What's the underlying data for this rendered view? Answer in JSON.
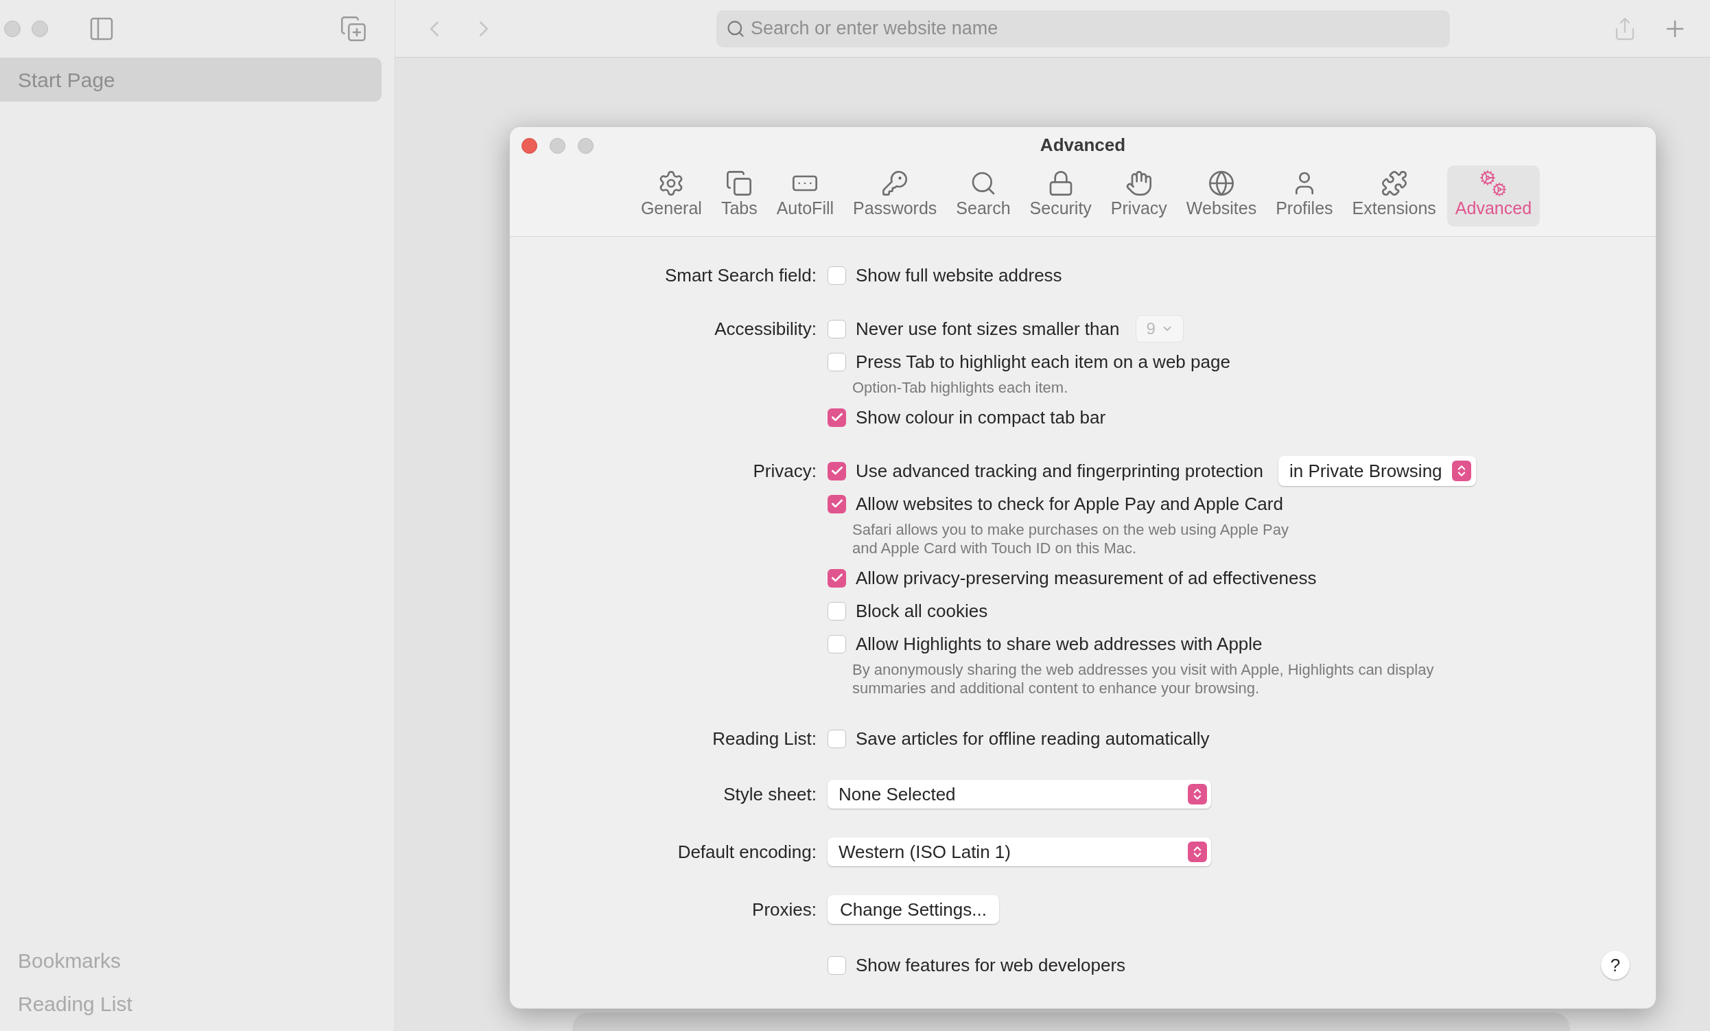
{
  "browser": {
    "search": {
      "placeholder": "Search or enter website name"
    }
  },
  "sidebar": {
    "items": [
      {
        "label": "Start Page",
        "selected": true
      }
    ],
    "footer": [
      {
        "label": "Bookmarks"
      },
      {
        "label": "Reading List"
      }
    ]
  },
  "settings": {
    "title": "Advanced",
    "tabs": [
      {
        "label": "General",
        "selected": false
      },
      {
        "label": "Tabs",
        "selected": false
      },
      {
        "label": "AutoFill",
        "selected": false
      },
      {
        "label": "Passwords",
        "selected": false
      },
      {
        "label": "Search",
        "selected": false
      },
      {
        "label": "Security",
        "selected": false
      },
      {
        "label": "Privacy",
        "selected": false
      },
      {
        "label": "Websites",
        "selected": false
      },
      {
        "label": "Profiles",
        "selected": false
      },
      {
        "label": "Extensions",
        "selected": false
      },
      {
        "label": "Advanced",
        "selected": true
      }
    ],
    "sections": [
      {
        "label": "Smart Search field:",
        "rows": [
          {
            "kind": "checkbox",
            "label": "Show full website address",
            "checked": false
          }
        ]
      },
      {
        "label": "Accessibility:",
        "rows": [
          {
            "kind": "checkbox",
            "label": "Never use font sizes smaller than",
            "checked": false,
            "size_popup": {
              "value": "9",
              "disabled": true
            }
          },
          {
            "kind": "checkbox",
            "label": "Press Tab to highlight each item on a web page",
            "checked": false,
            "hint": [
              "Option-Tab highlights each item."
            ]
          },
          {
            "kind": "checkbox",
            "label": "Show colour in compact tab bar",
            "checked": true
          }
        ]
      },
      {
        "label": "Privacy:",
        "rows": [
          {
            "kind": "checkbox",
            "label": "Use advanced tracking and fingerprinting protection",
            "checked": true,
            "popup": {
              "value": "in Private Browsing"
            }
          },
          {
            "kind": "checkbox",
            "label": "Allow websites to check for Apple Pay and Apple Card",
            "checked": true,
            "hint": [
              "Safari allows you to make purchases on the web using Apple Pay",
              "and Apple Card with Touch ID on this Mac."
            ]
          },
          {
            "kind": "checkbox",
            "label": "Allow privacy-preserving measurement of ad effectiveness",
            "checked": true
          },
          {
            "kind": "checkbox",
            "label": "Block all cookies",
            "checked": false
          },
          {
            "kind": "checkbox",
            "label": "Allow Highlights to share web addresses with Apple",
            "checked": false,
            "hint": [
              "By anonymously sharing the web addresses you visit with Apple, Highlights can display",
              "summaries and additional content to enhance your browsing."
            ]
          }
        ]
      },
      {
        "label": "Reading List:",
        "rows": [
          {
            "kind": "checkbox",
            "label": "Save articles for offline reading automatically",
            "checked": false
          }
        ]
      },
      {
        "label": "Style sheet:",
        "rows": [
          {
            "kind": "popup",
            "value": "None Selected"
          }
        ]
      },
      {
        "label": "Default encoding:",
        "rows": [
          {
            "kind": "popup",
            "value": "Western (ISO Latin 1)"
          }
        ]
      },
      {
        "label": "Proxies:",
        "rows": [
          {
            "kind": "button",
            "label": "Change Settings..."
          }
        ]
      },
      {
        "rows": [
          {
            "kind": "checkbox",
            "label": "Show features for web developers",
            "checked": false
          }
        ]
      }
    ],
    "help": {
      "label": "?"
    }
  }
}
